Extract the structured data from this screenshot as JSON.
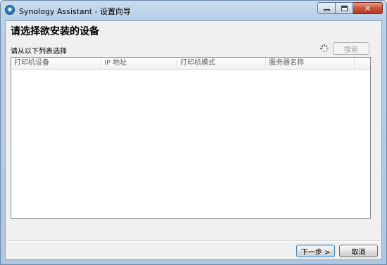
{
  "window": {
    "title": "Synology Assistant  - 设置向导"
  },
  "wizard": {
    "heading": "请选择欲安装的设备",
    "subheading": "请从以下列表选择",
    "search_label": "搜索"
  },
  "list": {
    "columns": [
      "打印机设备",
      "IP 地址",
      "打印机模式",
      "服务器名称",
      ""
    ],
    "rows": []
  },
  "footer": {
    "next_label": "下一步 >",
    "cancel_label": "取消"
  }
}
